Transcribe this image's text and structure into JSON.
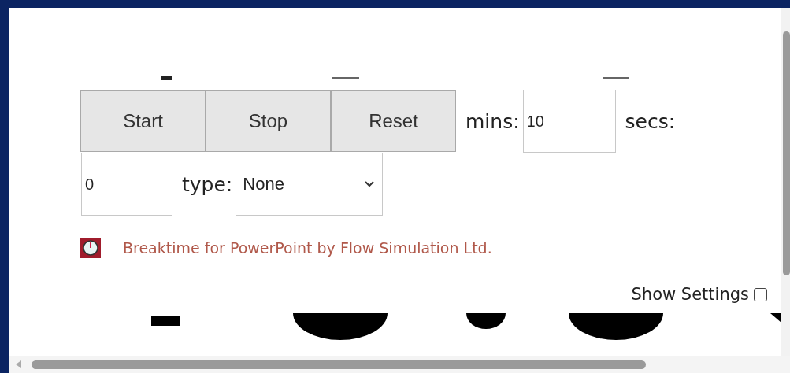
{
  "buttons": [
    {
      "label": "Start"
    },
    {
      "label": "Stop"
    },
    {
      "label": "Reset"
    }
  ],
  "mins": {
    "label": "mins:",
    "value": "10"
  },
  "secs": {
    "label": "secs:",
    "value": "0"
  },
  "type": {
    "label": "type:",
    "value": "None"
  },
  "credit": "Breaktime for PowerPoint by Flow Simulation Ltd.",
  "show_settings": {
    "label": "Show Settings",
    "checked": false
  }
}
